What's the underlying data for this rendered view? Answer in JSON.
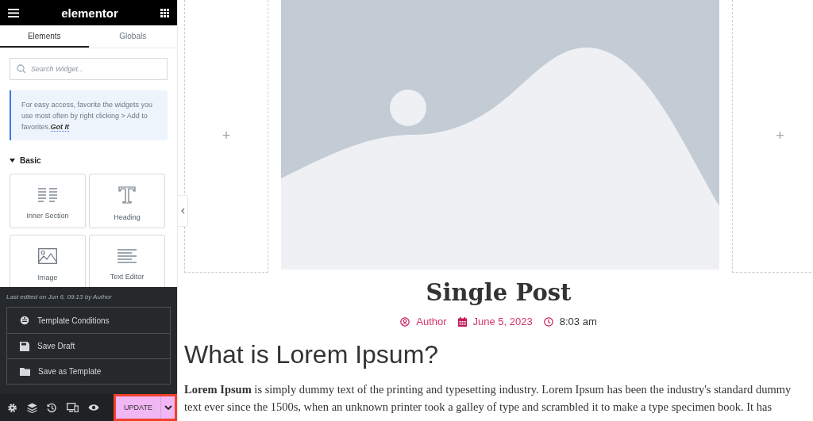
{
  "sidebar": {
    "logo": "elementor",
    "tabs": [
      {
        "label": "Elements",
        "selected": true
      },
      {
        "label": "Globals",
        "selected": false
      }
    ],
    "search": {
      "placeholder": "Search Widget..."
    },
    "tip": {
      "text": "For easy access, favorite the widgets you use most often by right clicking > Add to favorites.",
      "link": "Got It"
    },
    "section": {
      "label": "Basic",
      "expanded": true
    },
    "widgets": [
      {
        "label": "Inner Section",
        "kind": "columns"
      },
      {
        "label": "Heading",
        "kind": "heading"
      },
      {
        "label": "Image",
        "kind": "image"
      },
      {
        "label": "Text Editor",
        "kind": "text"
      }
    ],
    "publish_menu": {
      "last_edited": "Last edited on Jun 6, 09:13 by Author",
      "items": [
        {
          "label": "Template Conditions",
          "kind": "conditions"
        },
        {
          "label": "Save Draft",
          "kind": "draft"
        },
        {
          "label": "Save as Template",
          "kind": "folder"
        }
      ]
    },
    "footer": {
      "tools": [
        {
          "kind": "settings"
        },
        {
          "kind": "layers"
        },
        {
          "kind": "history"
        },
        {
          "kind": "responsive"
        },
        {
          "kind": "preview"
        }
      ],
      "update_button": {
        "label": "UPDATE",
        "highlighted": true
      }
    }
  },
  "canvas": {
    "add_buttons": [
      "+",
      "+"
    ],
    "title": "Single Post",
    "meta": [
      {
        "kind": "author",
        "text": "Author",
        "linked": true
      },
      {
        "kind": "date",
        "text": "June 5, 2023",
        "linked": true
      },
      {
        "kind": "time",
        "text": "8:03 am",
        "linked": false
      }
    ],
    "heading": "What is Lorem Ipsum?",
    "paragraph_lines": [
      "**Lorem Ipsum** is simply dummy text of the printing and typesetting industry. Lorem Ipsum has been the industry's standard dummy",
      "text ever since the 1500s, when an unknown printer took a galley of type and scrambled it to make a type specimen book. It has"
    ]
  }
}
